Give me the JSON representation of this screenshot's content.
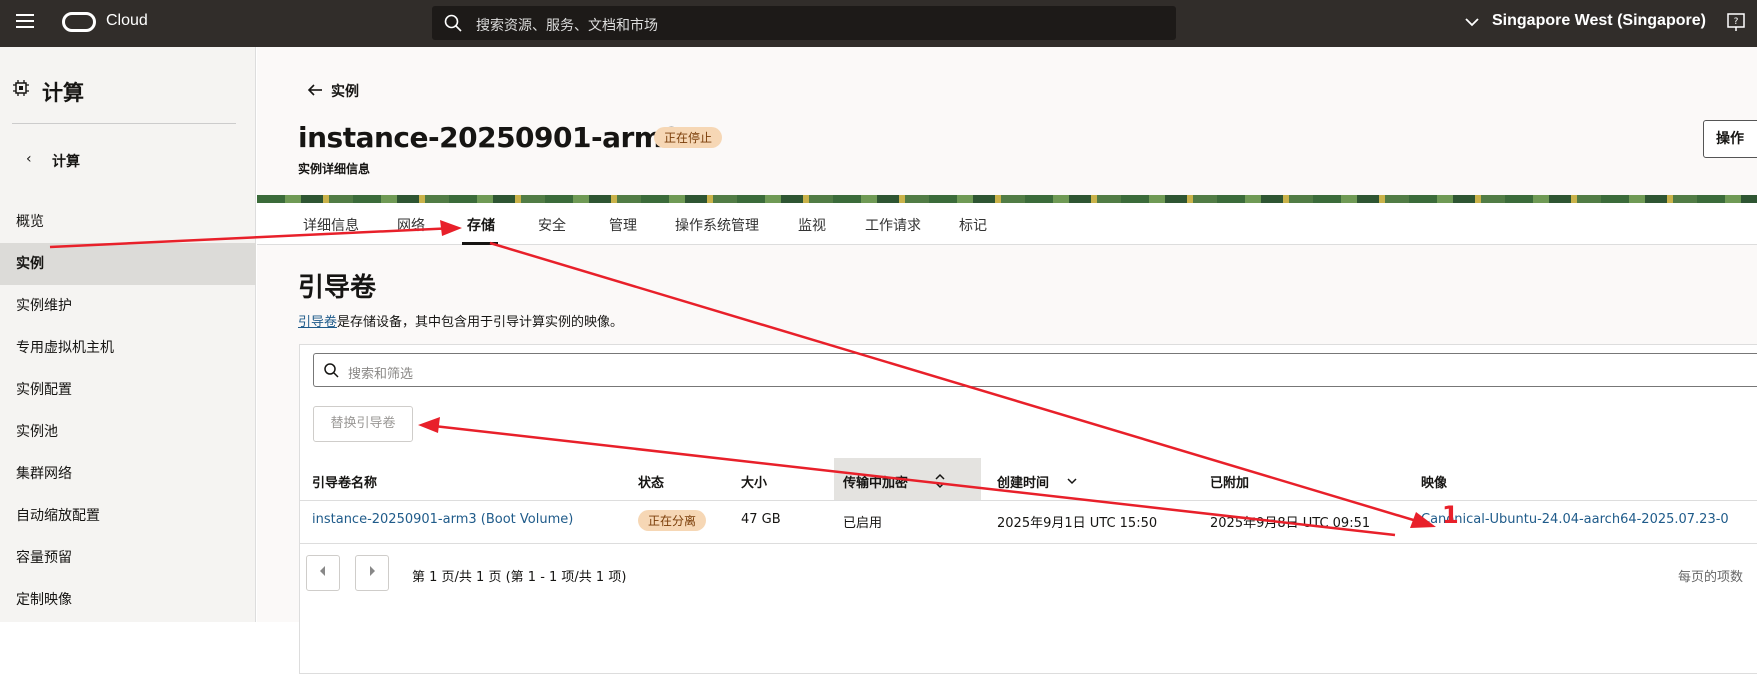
{
  "topbar": {
    "brand": "Cloud",
    "search_placeholder": "搜索资源、服务、文档和市场",
    "region": "Singapore West (Singapore)"
  },
  "sidebar": {
    "section": "计算",
    "back_label": "计算",
    "items": [
      "概览",
      "实例",
      "实例维护",
      "专用虚拟机主机",
      "实例配置",
      "实例池",
      "集群网络",
      "自动缩放配置",
      "容量预留",
      "定制映像"
    ]
  },
  "page": {
    "back_label": "实例",
    "title": "instance-20250901-arm3",
    "status": "正在停止",
    "subtitle": "实例详细信息",
    "action_label": "操作"
  },
  "tabs": [
    "详细信息",
    "网络",
    "存储",
    "安全",
    "管理",
    "操作系统管理",
    "监视",
    "工作请求",
    "标记"
  ],
  "section": {
    "title": "引导卷",
    "desc_link": "引导卷",
    "desc_rest": "是存储设备，其中包含用于引导计算实例的映像。",
    "filter_placeholder": "搜索和筛选",
    "replace_button": "替换引导卷",
    "columns": [
      "引导卷名称",
      "状态",
      "大小",
      "传输中加密",
      "创建时间",
      "已附加",
      "映像"
    ],
    "rows": [
      {
        "name": "instance-20250901-arm3 (Boot Volume)",
        "status": "正在分离",
        "size": "47 GB",
        "encryption": "已启用",
        "created": "2025年9月1日 UTC 15:50",
        "attached": "2025年9月8日 UTC 09:51",
        "image": "Canonical-Ubuntu-24.04-aarch64-2025.07.23-0"
      }
    ],
    "pagination": "第 1 页/共 1 页 (第 1 - 1 项/共 1 项)",
    "per_page": "每页的项数"
  },
  "annotation": {
    "marker": "1",
    "color": "#e8202a"
  }
}
